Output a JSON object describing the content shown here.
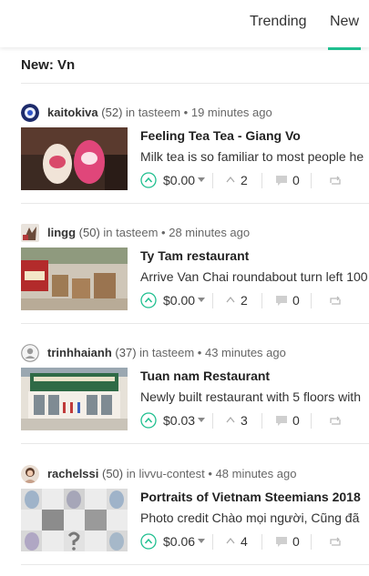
{
  "tabs": {
    "trending": "Trending",
    "new": "New"
  },
  "colors": {
    "accent": "#1fbf8f",
    "text": "#333333",
    "muted": "#666666"
  },
  "heading": "New: Vn",
  "posts": [
    {
      "author": "kaitokiva",
      "rep": "(52)",
      "in_text": "in",
      "community": "tasteem",
      "time": "19 minutes ago",
      "title": "Feeling Tea Tea - Giang Vo",
      "body": "Milk tea is so familiar to most people he",
      "payout": "$0.00",
      "votes": "2",
      "comments": "0"
    },
    {
      "author": "lingg",
      "rep": "(50)",
      "in_text": "in",
      "community": "tasteem",
      "time": "28 minutes ago",
      "title": "Ty Tam restaurant",
      "body": "Arrive Van Chai roundabout turn left 100",
      "payout": "$0.00",
      "votes": "2",
      "comments": "0"
    },
    {
      "author": "trinhhaianh",
      "rep": "(37)",
      "in_text": "in",
      "community": "tasteem",
      "time": "43 minutes ago",
      "title": "Tuan nam Restaurant",
      "body": "Newly built restaurant with 5 floors with",
      "payout": "$0.03",
      "votes": "3",
      "comments": "0"
    },
    {
      "author": "rachelssi",
      "rep": "(50)",
      "in_text": "in",
      "community": "livvu-contest",
      "time": "48 minutes ago",
      "title": "Portraits of Vietnam Steemians 2018",
      "body": "Photo credit Chào mọi người, Cũng đã",
      "payout": "$0.06",
      "votes": "4",
      "comments": "0"
    }
  ]
}
